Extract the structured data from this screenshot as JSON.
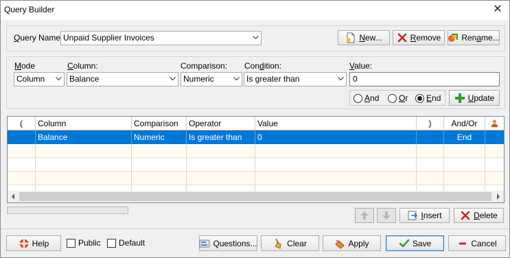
{
  "window": {
    "title": "Query Builder"
  },
  "query": {
    "label": "Query Name:",
    "label_mnemonic": "Q",
    "label_rest": "uery Name:",
    "value": "Unpaid Supplier Invoices",
    "new_mn": "N",
    "new_rest": "ew...",
    "remove_mn": "R",
    "remove_rest": "emove",
    "rename_pre": "Ren",
    "rename_mn": "a",
    "rename_rest": "me..."
  },
  "editor": {
    "mode_label_mn": "M",
    "mode_label_rest": "ode",
    "mode_value": "Column",
    "column_label_mn": "C",
    "column_label_rest": "olumn:",
    "column_value": "Balance",
    "comparison_label": "Comparison:",
    "comparison_value": "Numeric",
    "condition_pre": "Con",
    "condition_mn": "d",
    "condition_rest": "ition:",
    "condition_value": "Is greater than",
    "value_label_mn": "V",
    "value_label_rest": "alue:",
    "value_value": "0",
    "radio_and_mn": "A",
    "radio_and_rest": "nd",
    "radio_or_mn": "O",
    "radio_or_rest": "r",
    "radio_end_mn": "E",
    "radio_end_rest": "nd",
    "update_mn": "U",
    "update_rest": "pdate"
  },
  "grid": {
    "headers": [
      "(",
      "Column",
      "Comparison",
      "Operator",
      "Value",
      ")",
      "And/Or"
    ],
    "rows": [
      {
        "open": "",
        "column": "Balance",
        "comparison": "Numeric",
        "operator": "Is greater than",
        "value": "0",
        "close": "",
        "andor": "End"
      }
    ]
  },
  "actions": {
    "insert_mn": "I",
    "insert_rest": "nsert",
    "delete_mn": "D",
    "delete_rest": "elete"
  },
  "footer": {
    "help": "Help",
    "public": "Public",
    "default": "Default",
    "questions": "Questions...",
    "clear": "Clear",
    "apply": "Apply",
    "save": "Save",
    "cancel": "Cancel"
  },
  "colors": {
    "selection": "#0078d7",
    "row_alt": "#fffbf0",
    "accent_green": "#2e9d2e",
    "accent_red": "#c0262b"
  }
}
